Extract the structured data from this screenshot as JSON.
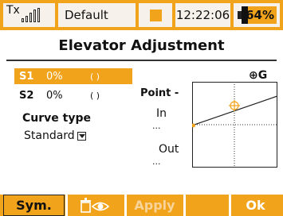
{
  "statusbar": {
    "tx_label": "Tx",
    "profile": "Default",
    "time": "12:22:06",
    "battery": "64%"
  },
  "title": "Elevator Adjustment",
  "sliders": [
    {
      "name": "S1",
      "value": "0%",
      "paren": "( )"
    },
    {
      "name": "S2",
      "value": "0%",
      "paren": "( )"
    }
  ],
  "curve": {
    "label": "Curve type",
    "value": "Standard"
  },
  "point": {
    "label": "Point -",
    "in_label": "In",
    "in_value": "...",
    "out_label": "Out",
    "out_value": "..."
  },
  "graph": {
    "marker_label": "⊕G"
  },
  "footer": {
    "sym": "Sym.",
    "apply": "Apply",
    "ok": "Ok"
  },
  "colors": {
    "accent": "#f2a31c",
    "background": "#ffffff"
  }
}
